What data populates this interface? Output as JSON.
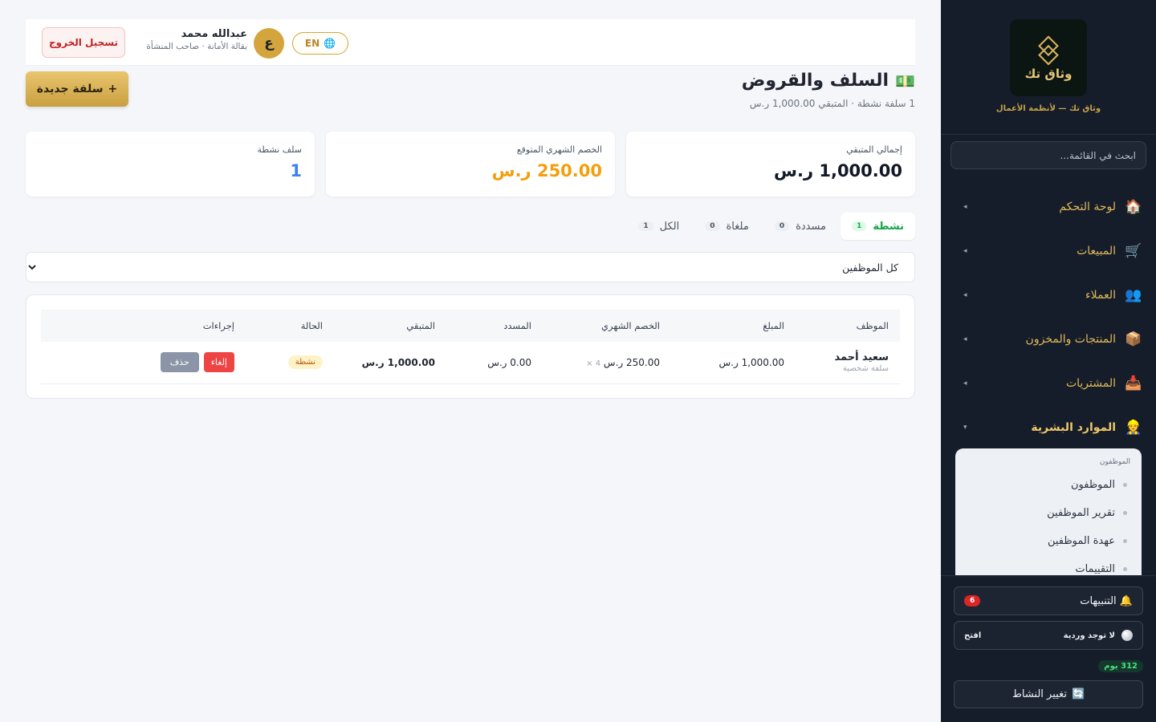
{
  "colors": {
    "sidebar_bg": "#161d2a",
    "gold": "#d3a53c",
    "success": "#16a34a",
    "danger": "#ef4444",
    "warning": "#f59e0b",
    "primary_blue": "#3b82f6"
  },
  "sidebar": {
    "brand_name": "وثاق تك",
    "tagline": "وثاق تك — لأنظمة الأعمال",
    "search_placeholder": "ابحث في القائمة...",
    "nav": [
      {
        "label": "لوحة التحكم",
        "icon": "home-icon",
        "glyph": "🏠"
      },
      {
        "label": "المبيعات",
        "icon": "cart-icon",
        "glyph": "🛒"
      },
      {
        "label": "العملاء",
        "icon": "users-icon",
        "glyph": "👥"
      },
      {
        "label": "المنتجات والمخزون",
        "icon": "box-icon",
        "glyph": "📦"
      },
      {
        "label": "المشتريات",
        "icon": "inbox-icon",
        "glyph": "📥"
      },
      {
        "label": "الموارد البشرية",
        "icon": "person-icon",
        "glyph": "👷"
      }
    ],
    "submenu": {
      "header": "الموظفون",
      "items": [
        "الموظفون",
        "تقرير الموظفين",
        "عهدة الموظفين",
        "التقييمات"
      ]
    },
    "notifications": {
      "label": "التنبيهات",
      "count": "6",
      "glyph": "🔔"
    },
    "shift": {
      "status": "لا توجد وردية",
      "open_label": "افتح"
    },
    "days_badge": "312 يوم",
    "change_activity": {
      "label": "تغيير النشاط",
      "glyph": "🔄"
    }
  },
  "header": {
    "logout_label": "تسجيل الخروج",
    "user_name": "عبدالله محمد",
    "user_role": "بقالة الأمانة · صاحب المنشأة",
    "avatar_letter": "ع",
    "lang_label": "EN"
  },
  "page": {
    "title": "السلف والقروض",
    "title_glyph": "💵",
    "subtitle": "1 سلفة نشطة · المتبقي 1,000.00 ر.س",
    "new_button": "سلفة جديدة",
    "new_button_plus": "+"
  },
  "stats": [
    {
      "label": "إجمالي المتبقي",
      "value": "1,000.00 ر.س",
      "color": "#111827"
    },
    {
      "label": "الخصم الشهري المتوقع",
      "value": "250.00 ر.س",
      "color": "#f59e0b"
    },
    {
      "label": "سلف نشطة",
      "value": "1",
      "color": "#3b82f6"
    }
  ],
  "tabs": [
    {
      "label": "نشطة",
      "count": "1"
    },
    {
      "label": "مسددة",
      "count": "0"
    },
    {
      "label": "ملغاة",
      "count": "0"
    },
    {
      "label": "الكل",
      "count": "1"
    }
  ],
  "filter": {
    "selected": "كل الموظفين"
  },
  "table": {
    "headers": [
      "الموظف",
      "المبلغ",
      "الخصم الشهري",
      "المسدد",
      "المتبقي",
      "الحالة",
      "إجراءات"
    ],
    "rows": [
      {
        "employee": "سعيد أحمد",
        "type": "سلفة شخصية",
        "amount": "1,000.00 ر.س",
        "monthly": "250.00 ر.س",
        "installments": "4 ×",
        "paid": "0.00 ر.س",
        "remaining": "1,000.00 ر.س",
        "status": "نشطة",
        "cancel_label": "إلغاء",
        "delete_label": "حذف"
      }
    ]
  }
}
